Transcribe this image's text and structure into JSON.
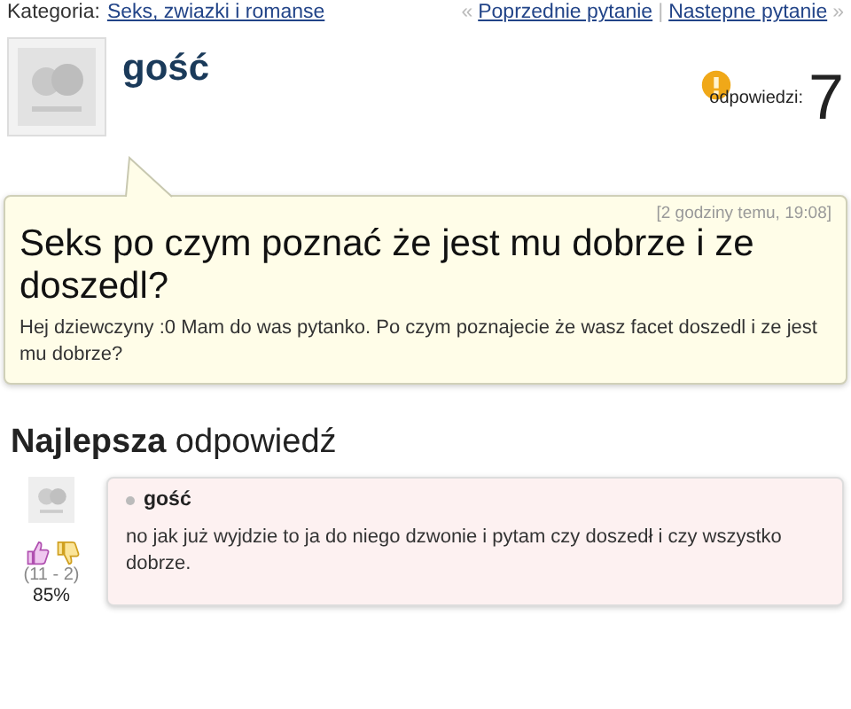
{
  "breadcrumb": {
    "label": "Kategoria:",
    "category": "Seks, zwiazki i romanse"
  },
  "nav": {
    "prev_mark": "«",
    "prev": "Poprzednie pytanie",
    "separator": "|",
    "next": "Nastepne pytanie",
    "next_mark": "»"
  },
  "question": {
    "author": "gość",
    "answers_label": "odpowiedzi:",
    "answers_count": "7",
    "time": "[2 godziny temu, 19:08]",
    "title": "Seks po czym poznać że jest mu dobrze i ze doszedl?",
    "body": "Hej dziewczyny :0 Mam do was pytanko. Po czym poznajecie że wasz facet doszedl i ze jest mu dobrze?"
  },
  "best_answer": {
    "heading_bold": "Najlepsza",
    "heading_rest": "odpowiedź",
    "author": "gość",
    "text": "no jak już wyjdzie to ja do niego dzwonie i pytam czy doszedł i czy wszystko dobrze.",
    "votes": "(11 - 2)",
    "percent": "85%"
  }
}
